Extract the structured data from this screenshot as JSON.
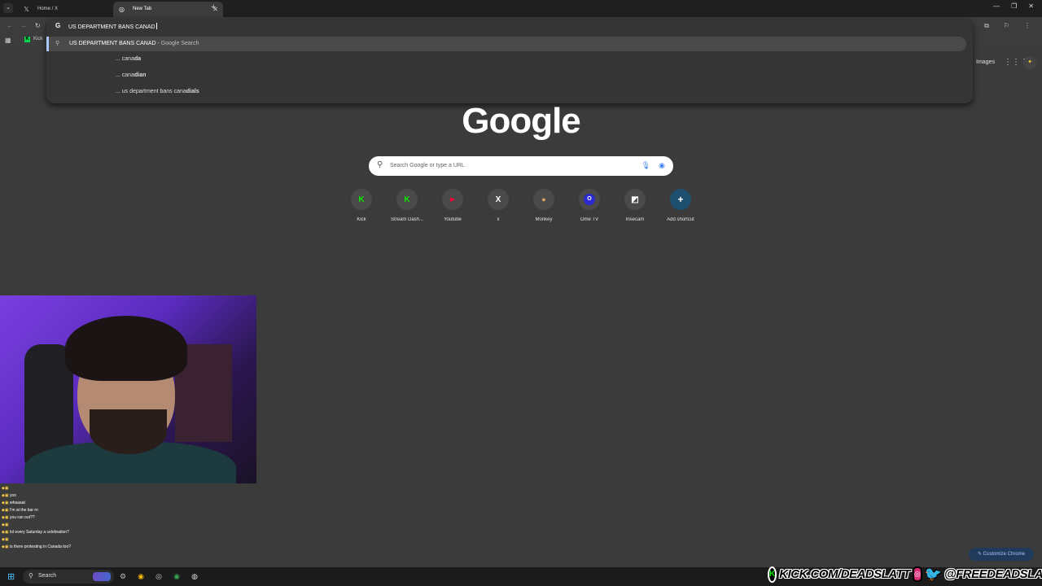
{
  "tabs": [
    {
      "title": "Home / X",
      "favicon": "x-icon",
      "active": false
    },
    {
      "title": "New Tab",
      "favicon": "chrome-icon",
      "active": true
    }
  ],
  "bookmarks": {
    "kick_label": "Kick"
  },
  "omnibox": {
    "input": "US DEPARTMENT BANS CANAD",
    "selected_suggestion": "US DEPARTMENT BANS CANAD",
    "selected_suffix": " - Google Search",
    "suggestions": [
      {
        "prefix": "... cana",
        "bold": "da"
      },
      {
        "prefix": "... cana",
        "bold": "dian"
      },
      {
        "prefix": "... us department bans cana",
        "bold": "dials"
      }
    ]
  },
  "header": {
    "images_link": "Images"
  },
  "google": {
    "logo": "Google",
    "search_placeholder": "Search Google or type a URL"
  },
  "shortcuts": [
    {
      "label": "Kick",
      "icon": "kick-icon",
      "color": "#00e701",
      "glyph": "K"
    },
    {
      "label": "Stream Dash...",
      "icon": "kick-icon",
      "color": "#00e701",
      "glyph": "K"
    },
    {
      "label": "Youtube",
      "icon": "youtube-icon",
      "color": "#ff0033",
      "glyph": "▶"
    },
    {
      "label": "x",
      "icon": "x-icon",
      "color": "#ffffff",
      "glyph": "X"
    },
    {
      "label": "Monkey",
      "icon": "monkey-icon",
      "color": "#d9a066",
      "glyph": "🐵"
    },
    {
      "label": "Ome TV",
      "icon": "ometv-icon",
      "color": "#2a2ad0",
      "glyph": "O"
    },
    {
      "label": "Insecam",
      "icon": "insecam-icon",
      "color": "#ffffff",
      "glyph": "◩"
    },
    {
      "label": "Add shortcut",
      "icon": "plus-icon",
      "color": "#ffffff",
      "glyph": "+"
    }
  ],
  "chat": [
    {
      "user": "",
      "message": ""
    },
    {
      "user": "",
      "message": "yoo"
    },
    {
      "user": "",
      "message": "whaaaat"
    },
    {
      "user": "",
      "message": "I'm at the bar rn"
    },
    {
      "user": "",
      "message": "you ran out??"
    },
    {
      "user": "",
      "message": ""
    },
    {
      "user": "",
      "message": "lol every Saturday a celebration?"
    },
    {
      "user": "",
      "message": ""
    },
    {
      "user": "",
      "message": "is there protesting in Canada too?"
    }
  ],
  "customize_button": "Customize Chrome",
  "taskbar": {
    "search_label": "Search"
  },
  "overlay": {
    "kick_text": "KICK.COM/DEADSLATT",
    "social_text": "@FREEDEADSLATT"
  },
  "colors": {
    "accent": "#a8c7fa",
    "kick_green": "#00e701",
    "background": "#3b3b3b"
  }
}
